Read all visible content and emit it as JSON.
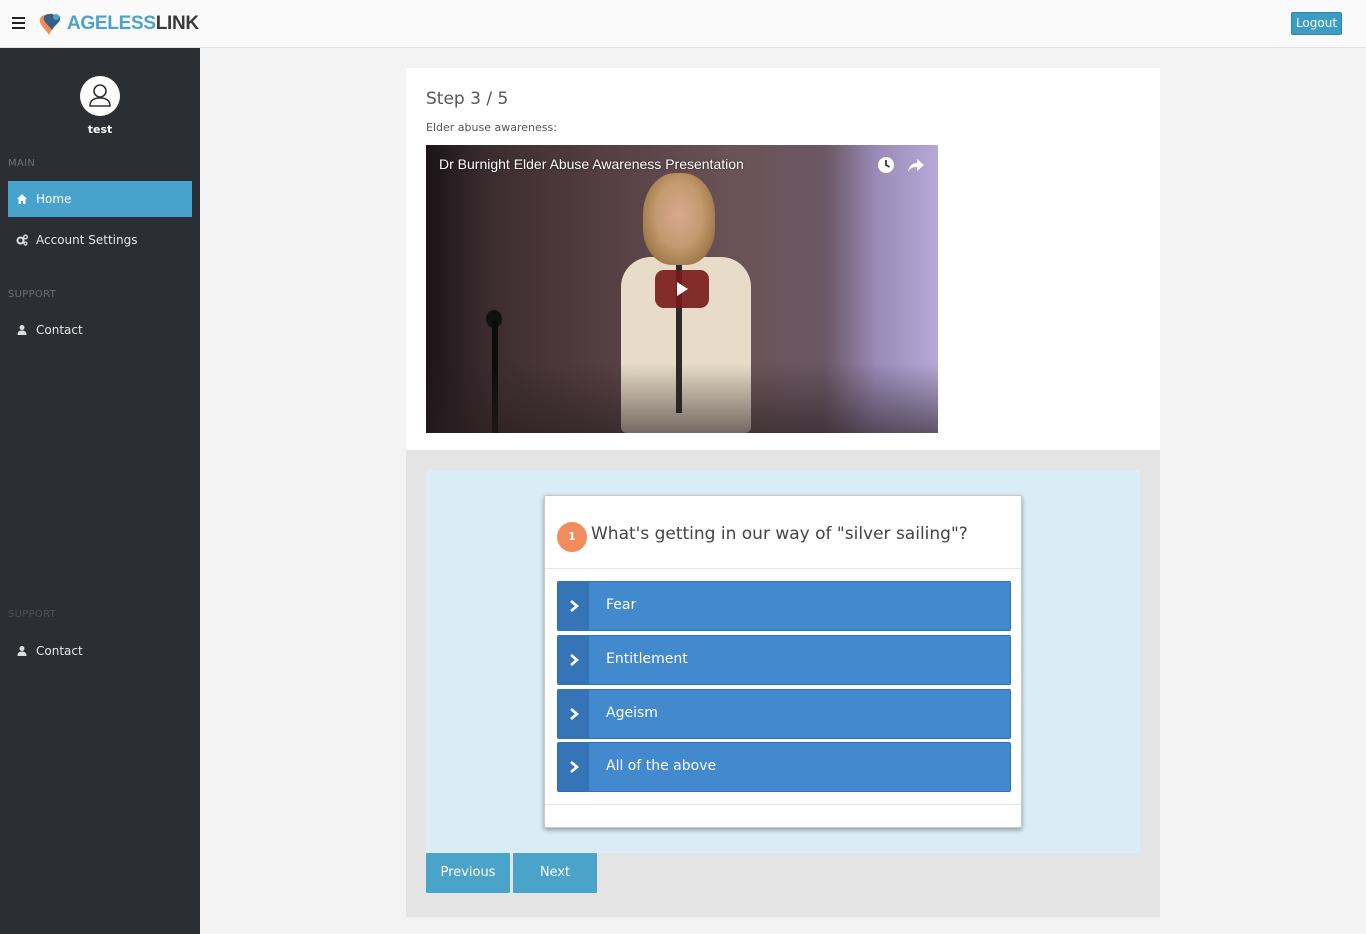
{
  "topbar": {
    "logo_part1": "AGELESS",
    "logo_part2": "LINK",
    "logout_label": "Logout"
  },
  "sidebar": {
    "username": "test",
    "section_main": "MAIN",
    "section_support": "SUPPORT",
    "section_support_2": "SUPPORT",
    "items": [
      {
        "label": "Home",
        "icon": "home-icon",
        "active": true
      },
      {
        "label": "Account Settings",
        "icon": "gears-icon",
        "active": false
      },
      {
        "label": "Contact",
        "icon": "user-icon",
        "active": false
      },
      {
        "label": "Contact",
        "icon": "user-icon",
        "active": false
      }
    ]
  },
  "main": {
    "step": "Step 3 / 5",
    "subtitle": "Elder abuse awareness:",
    "video_title": "Dr Burnight Elder Abuse Awareness Presentation"
  },
  "quiz": {
    "number": "1",
    "question": "What's getting in our way of \"silver sailing\"?",
    "options": [
      "Fear",
      "Entitlement",
      "Ageism",
      "All of the above"
    ],
    "previous_label": "Previous",
    "next_label": "Next"
  },
  "colors": {
    "accent": "#47a3cc",
    "sidebar_bg": "#2b2f33",
    "option_bg": "#4289cd",
    "number_badge": "#f28c5c"
  }
}
